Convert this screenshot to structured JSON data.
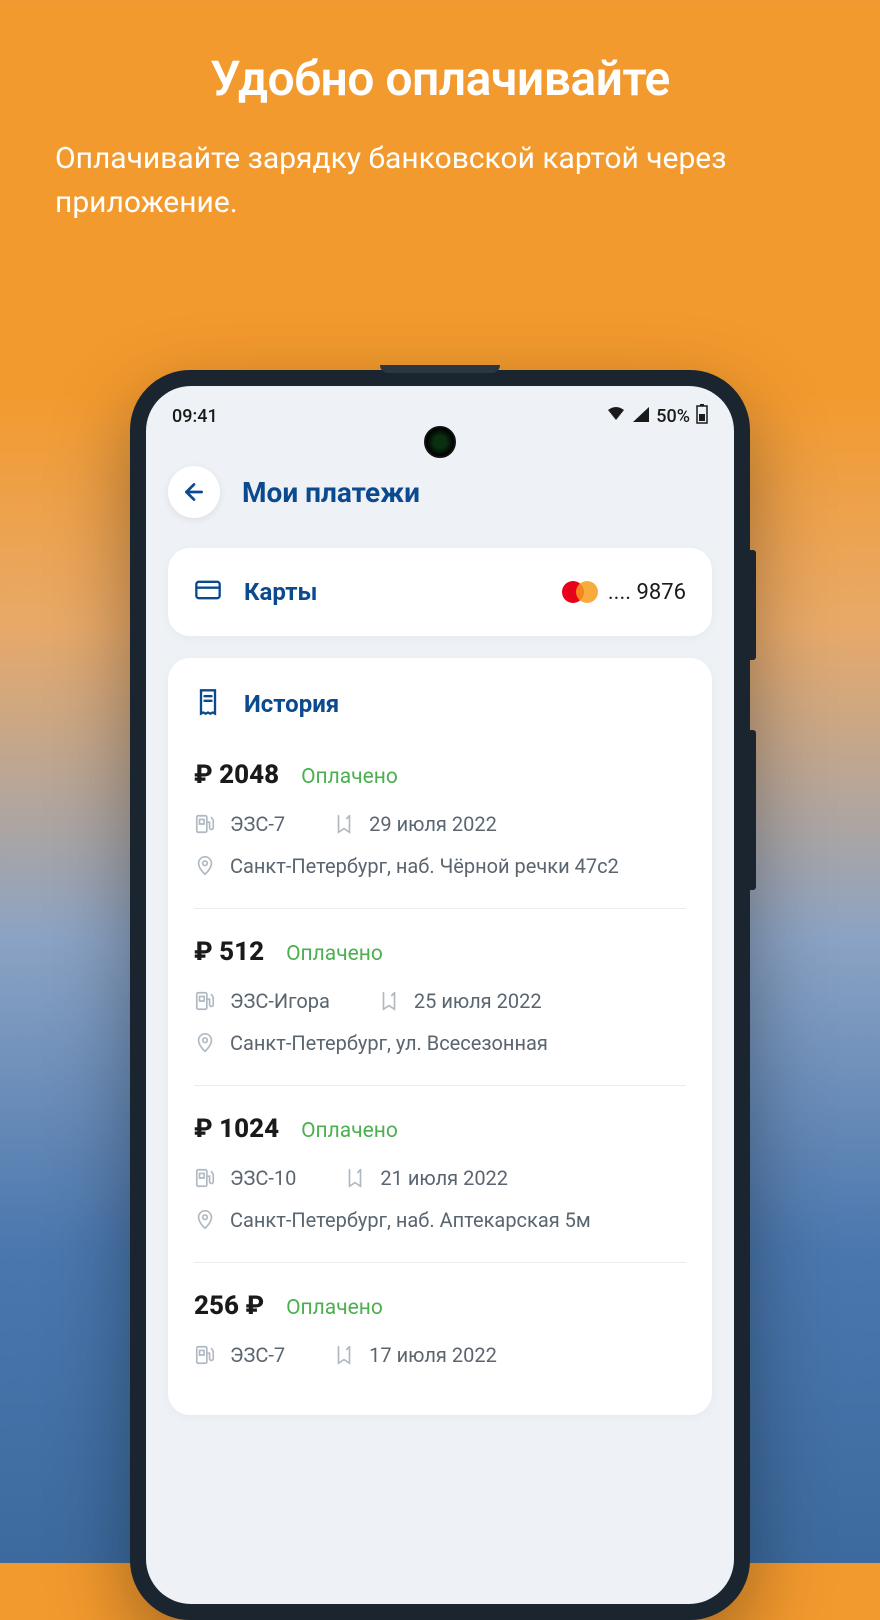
{
  "promo": {
    "title": "Удобно оплачивайте",
    "subtitle": "Оплачивайте зарядку банковской картой через приложение."
  },
  "statusbar": {
    "time": "09:41",
    "battery": "50%"
  },
  "header": {
    "title": "Мои платежи"
  },
  "cards": {
    "label": "Карты",
    "masked": ".... 9876"
  },
  "history": {
    "label": "История",
    "items": [
      {
        "amount": "₽ 2048",
        "status": "Оплачено",
        "station": "ЭЗС-7",
        "date": "29 июля  2022",
        "address": "Санкт-Петербург, наб. Чёрной речки 47с2"
      },
      {
        "amount": "₽ 512",
        "status": "Оплачено",
        "station": "ЭЗС-Игора",
        "date": "25 июля  2022",
        "address": "Санкт-Петербург, ул. Всесезонная"
      },
      {
        "amount": "₽ 1024",
        "status": "Оплачено",
        "station": "ЭЗС-10",
        "date": "21 июля  2022",
        "address": "Санкт-Петербург, наб. Аптекарская 5м"
      },
      {
        "amount": "256 ₽",
        "status": "Оплачено",
        "station": "ЭЗС-7",
        "date": "17 июля  2022",
        "address": ""
      }
    ]
  }
}
